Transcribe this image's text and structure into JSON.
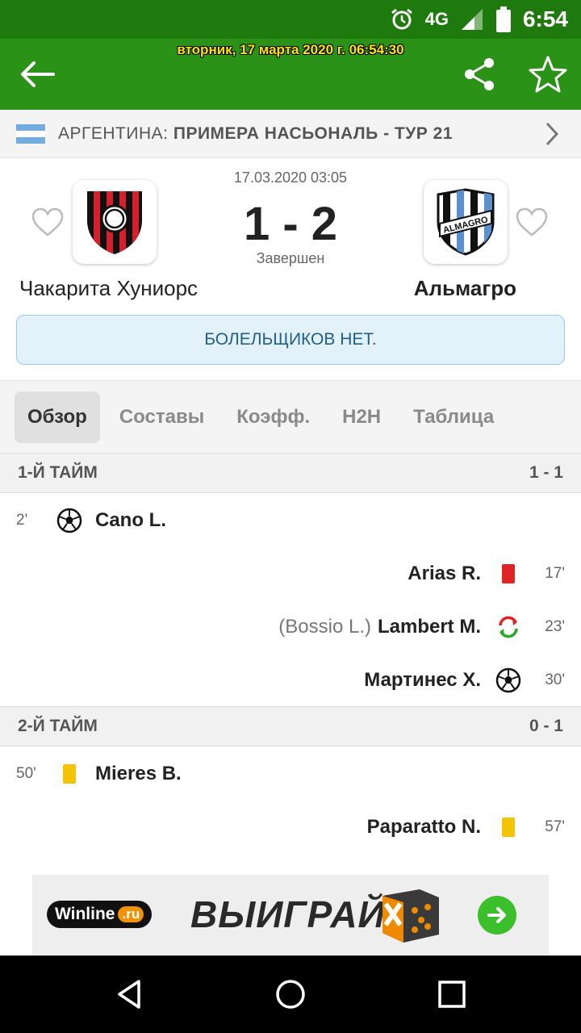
{
  "status_bar": {
    "network": "4G",
    "time": "6:54",
    "icons": [
      "alarm-icon",
      "signal-icon",
      "battery-icon"
    ]
  },
  "app_bar": {
    "datetime": "вторник, 17 марта 2020 г. 06:54:30",
    "icons": [
      "back-arrow-icon",
      "share-icon",
      "star-icon"
    ]
  },
  "league": {
    "country": "АРГЕНТИНА:",
    "name": "ПРИМЕРА НАСЬОНАЛЬ - ТУР 21"
  },
  "match": {
    "datetime": "17.03.2020 03:05",
    "score": "1 - 2",
    "status": "Завершен",
    "home_team": "Чакарита Хуниорс",
    "away_team": "Альмагро",
    "notice": "БОЛЕЛЬЩИКОВ НЕТ.",
    "away_logo_text": "ALMAGRO"
  },
  "tabs": [
    "Обзор",
    "Составы",
    "Коэфф.",
    "H2H",
    "Таблица"
  ],
  "first_half": {
    "title": "1-Й ТАЙМ",
    "score": "1 - 1",
    "events": [
      {
        "side": "home",
        "minute": "2'",
        "type": "goal",
        "player": "Cano L."
      },
      {
        "side": "away",
        "minute": "17'",
        "type": "red-card",
        "player": "Arias R."
      },
      {
        "side": "away",
        "minute": "23'",
        "type": "substitution",
        "player": "Lambert M.",
        "sub": "(Bossio L.)"
      },
      {
        "side": "away",
        "minute": "30'",
        "type": "goal",
        "player": "Мартинес Х."
      }
    ]
  },
  "second_half": {
    "title": "2-Й ТАЙМ",
    "score": "0 - 1",
    "events": [
      {
        "side": "home",
        "minute": "50'",
        "type": "yellow-card",
        "player": "Mieres B."
      },
      {
        "side": "away",
        "minute": "57'",
        "type": "yellow-card",
        "player": "Paparatto N."
      }
    ]
  },
  "ad": {
    "brand": "Winline",
    "brand_suffix": ".ru",
    "cta": "ВЫИГРАЙ"
  },
  "colors": {
    "header_green": "#2a9217",
    "status_green": "#1f7a0e",
    "red_card": "#e02424",
    "yellow_card": "#f5c400",
    "notice_bg": "#e3f1fb"
  }
}
